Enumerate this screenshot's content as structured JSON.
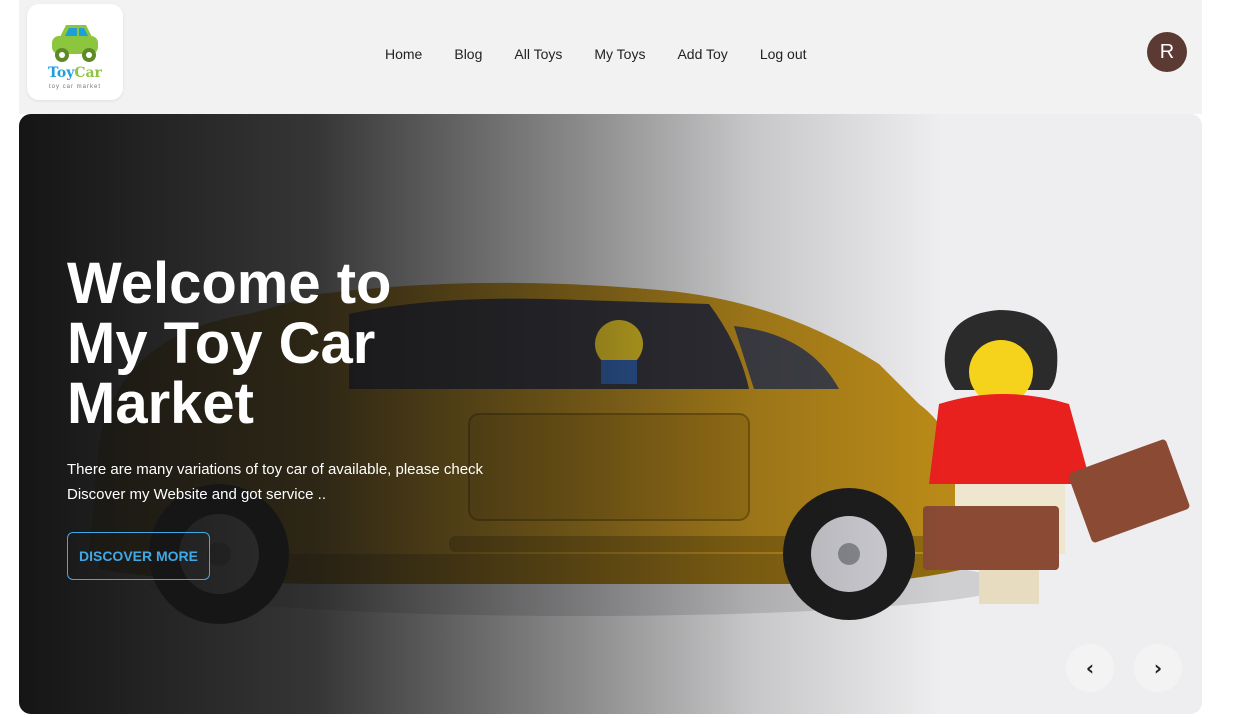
{
  "logo": {
    "name_part1": "Toy",
    "name_part2": "Car",
    "tagline": "toy car market"
  },
  "nav": {
    "items": [
      {
        "label": "Home"
      },
      {
        "label": "Blog"
      },
      {
        "label": "All Toys"
      },
      {
        "label": "My Toys"
      },
      {
        "label": "Add Toy"
      },
      {
        "label": "Log out"
      }
    ]
  },
  "user": {
    "avatar_initial": "R",
    "avatar_color": "#5a3a33"
  },
  "hero": {
    "title": "Welcome to My Toy Car Market",
    "description": "There are many variations of toy car of available, please check Discover my Website and got service ..",
    "button_label": "DISCOVER MORE",
    "accent_color": "#3fa9e6",
    "prev_icon": "chevron-left-icon",
    "next_icon": "chevron-right-icon",
    "prev_glyph": "‹",
    "next_glyph": "›"
  }
}
